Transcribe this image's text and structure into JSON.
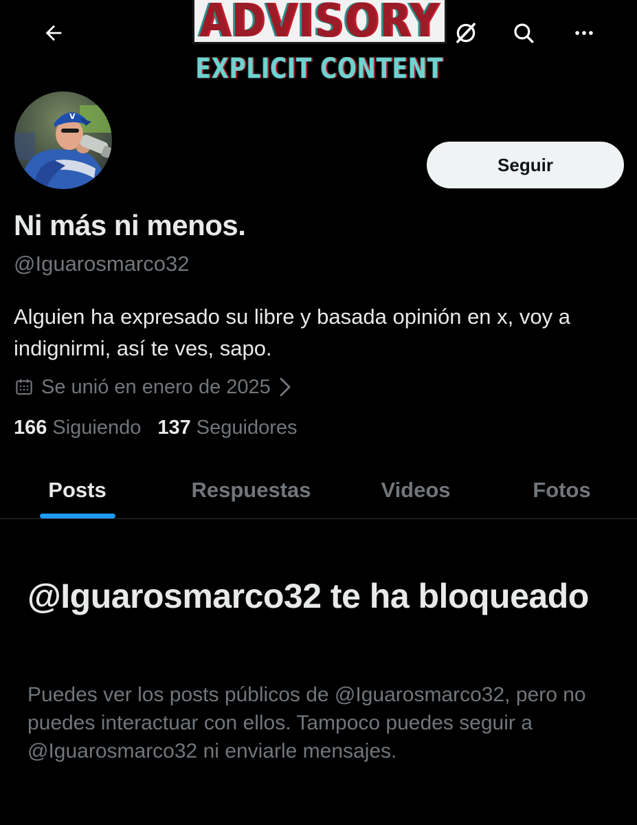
{
  "banner": {
    "advisory_text": "ADVISORY",
    "explicit_text": "EXPLICIT CONTENT"
  },
  "header": {
    "icons": {
      "back": "arrow-left-icon",
      "grok": "grok-icon",
      "search": "search-icon",
      "more": "more-horizontal-icon"
    }
  },
  "profile": {
    "follow_label": "Seguir",
    "display_name": "Ni más ni menos.",
    "handle": "@Iguarosmarco32",
    "bio": "Alguien ha expresado su libre y basada opinión en x, voy a indignirmi, así te ves, sapo.",
    "joined": "Se unió en enero de 2025",
    "following_count": "166",
    "following_label": "Siguiendo",
    "followers_count": "137",
    "followers_label": "Seguidores"
  },
  "tabs": [
    {
      "label": "Posts",
      "active": true
    },
    {
      "label": "Respuestas",
      "active": false
    },
    {
      "label": "Videos",
      "active": false
    },
    {
      "label": "Fotos",
      "active": false
    }
  ],
  "blocked": {
    "title": "@Iguarosmarco32 te ha bloqueado",
    "body": "Puedes ver los posts públicos de @Iguarosmarco32, pero no puedes interactuar con ellos. Tampoco puedes seguir a @Iguarosmarco32 ni enviarle mensajes."
  },
  "colors": {
    "background": "#000000",
    "text_primary": "#e7e9ea",
    "text_secondary": "#71767b",
    "accent": "#1d9bf0",
    "follow_button_bg": "#eff3f4"
  }
}
